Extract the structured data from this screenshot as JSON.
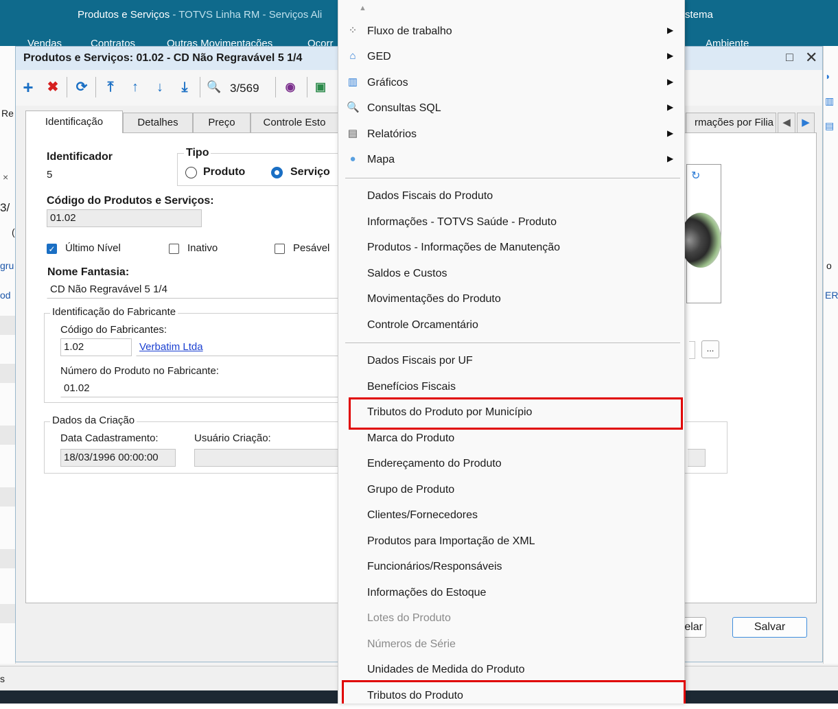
{
  "app": {
    "title_main": "Produtos e Serviços",
    "title_sub": " - TOTVS Linha RM - Serviços  Ali",
    "title_right": "stema",
    "menubar": [
      "Vendas",
      "Contratos",
      "Outras Movimentações",
      "Ocorr",
      "Ambiente"
    ],
    "left_peek": [
      "Re",
      "×",
      "3/",
      "(",
      "gru",
      "od"
    ],
    "right_peek": [
      "o",
      "ER",
      "s"
    ],
    "status_left": "s"
  },
  "dialog": {
    "title": "Produtos e Serviços: 01.02 - CD Não Regravável 5 1/4",
    "maximize_icon": "□",
    "close_icon": "✕",
    "toolbar": {
      "add": "+",
      "delete": "✖",
      "refresh": "⟳",
      "first": "⤒",
      "prev": "↑",
      "next": "↓",
      "last": "⤓",
      "search": "🔍",
      "record_position": "3/569"
    },
    "tabs": [
      "Identificação",
      "Detalhes",
      "Preço",
      "Controle Esto",
      "rmações por Filia"
    ],
    "tab_nav": [
      "◀",
      "▶"
    ],
    "form": {
      "identificador_label": "Identificador",
      "identificador_value": "5",
      "tipo_label": "Tipo",
      "tipo_options": [
        "Produto",
        "Serviço"
      ],
      "tipo_selected": "Serviço",
      "codigo_label": "Código do Produtos e Serviços:",
      "codigo_value": "01.02",
      "checkboxes": [
        {
          "label": "Último Nível",
          "checked": true
        },
        {
          "label": "Inativo",
          "checked": false
        },
        {
          "label": "Pesável",
          "checked": false
        }
      ],
      "nome_fantasia_label": "Nome Fantasia:",
      "nome_fantasia_value": "CD Não Regravável 5 1/4",
      "fabricante_group": "Identificação do Fabricante",
      "codigo_fabricantes_label": "Código do Fabricantes:",
      "codigo_fabricantes_value": "1.02",
      "fabricante_link": "Verbatim Ltda",
      "numero_produto_label": "Número do Produto no Fabricante:",
      "numero_produto_value": "01.02",
      "criacao_group": "Dados da Criação",
      "data_cadastramento_label": "Data Cadastramento:",
      "data_cadastramento_value": "18/03/1996 00:00:00",
      "usuario_criacao_label": "Usuário Criação:",
      "usuario_criacao_value": "",
      "ellipsis_button": "..."
    },
    "buttons": {
      "cancel": "celar",
      "save": "Salvar"
    }
  },
  "context_menu": {
    "scroll_up_icon": "▲",
    "submenus": [
      {
        "label": "Fluxo de trabalho",
        "icon": "workflow-icon",
        "glyph": "⁘"
      },
      {
        "label": "GED",
        "icon": "ged-icon",
        "glyph": "⌂"
      },
      {
        "label": "Gráficos",
        "icon": "chart-icon",
        "glyph": "▥"
      },
      {
        "label": "Consultas SQL",
        "icon": "search-icon",
        "glyph": "🔍"
      },
      {
        "label": "Relatórios",
        "icon": "report-icon",
        "glyph": "▤"
      },
      {
        "label": "Mapa",
        "icon": "map-pin-icon",
        "glyph": "●"
      }
    ],
    "group1": [
      "Dados Fiscais do Produto",
      "Informações - TOTVS Saúde - Produto",
      "Produtos - Informações de Manutenção",
      "Saldos e Custos",
      "Movimentações do Produto",
      "Controle Orcamentário"
    ],
    "group2": [
      {
        "label": "Dados Fiscais por UF",
        "disabled": false
      },
      {
        "label": "Benefícios Fiscais",
        "disabled": false
      },
      {
        "label": "Tributos do Produto por Município",
        "disabled": false,
        "highlighted": true
      },
      {
        "label": "Marca do Produto",
        "disabled": false
      },
      {
        "label": "Endereçamento do Produto",
        "disabled": false
      },
      {
        "label": "Grupo de Produto",
        "disabled": false
      },
      {
        "label": "Clientes/Fornecedores",
        "disabled": false
      },
      {
        "label": "Produtos para Importação de XML",
        "disabled": false
      },
      {
        "label": "Funcionários/Responsáveis",
        "disabled": false
      },
      {
        "label": "Informações do Estoque",
        "disabled": false
      },
      {
        "label": "Lotes do Produto",
        "disabled": true
      },
      {
        "label": "Números de Série",
        "disabled": true
      },
      {
        "label": "Unidades de Medida do Produto",
        "disabled": false
      },
      {
        "label": "Tributos do Produto",
        "disabled": false,
        "highlighted": true
      }
    ],
    "highlight_color": "#e00000"
  }
}
